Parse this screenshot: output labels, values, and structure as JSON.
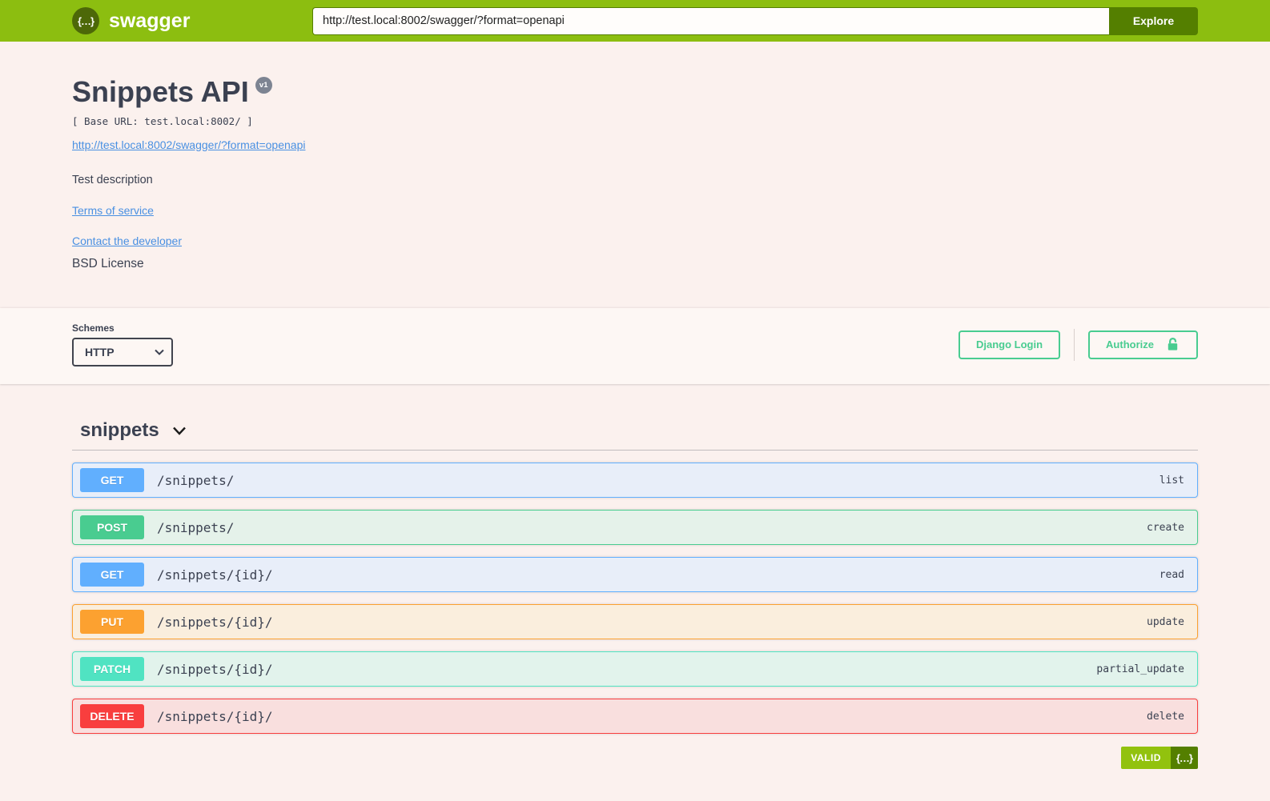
{
  "topbar": {
    "brand": "swagger",
    "logo_glyph": "{…}",
    "url_value": "http://test.local:8002/swagger/?format=openapi",
    "explore_label": "Explore"
  },
  "info": {
    "title": "Snippets API",
    "version_badge": "v1",
    "base_url": "[ Base URL: test.local:8002/ ]",
    "spec_link": "http://test.local:8002/swagger/?format=openapi",
    "description": "Test description",
    "links": [
      {
        "label": "Terms of service"
      },
      {
        "label": "Contact the developer"
      }
    ],
    "license": "BSD License"
  },
  "schemes": {
    "label": "Schemes",
    "selected": "HTTP"
  },
  "auth": {
    "django_login_label": "Django Login",
    "authorize_label": "Authorize"
  },
  "tag": {
    "name": "snippets"
  },
  "operations": [
    {
      "method": "GET",
      "path": "/snippets/",
      "summary": "list",
      "color": "#61affe",
      "row_bg": "#e8eef9"
    },
    {
      "method": "POST",
      "path": "/snippets/",
      "summary": "create",
      "color": "#49cc90",
      "row_bg": "#e5f2ea"
    },
    {
      "method": "GET",
      "path": "/snippets/{id}/",
      "summary": "read",
      "color": "#61affe",
      "row_bg": "#e8eef9"
    },
    {
      "method": "PUT",
      "path": "/snippets/{id}/",
      "summary": "update",
      "color": "#fca130",
      "row_bg": "#faeedd"
    },
    {
      "method": "PATCH",
      "path": "/snippets/{id}/",
      "summary": "partial_update",
      "color": "#50e3c2",
      "row_bg": "#e2f3ec"
    },
    {
      "method": "DELETE",
      "path": "/snippets/{id}/",
      "summary": "delete",
      "color": "#f93e3e",
      "row_bg": "#f9dfde"
    }
  ],
  "validator": {
    "status": "VALID",
    "glyph": "{…}"
  },
  "colors": {
    "topbar": "#8cbe10",
    "explore_bg": "#547f00",
    "accent_green": "#49cc90",
    "link_blue": "#4990e2",
    "text_dark": "#3b4151"
  }
}
